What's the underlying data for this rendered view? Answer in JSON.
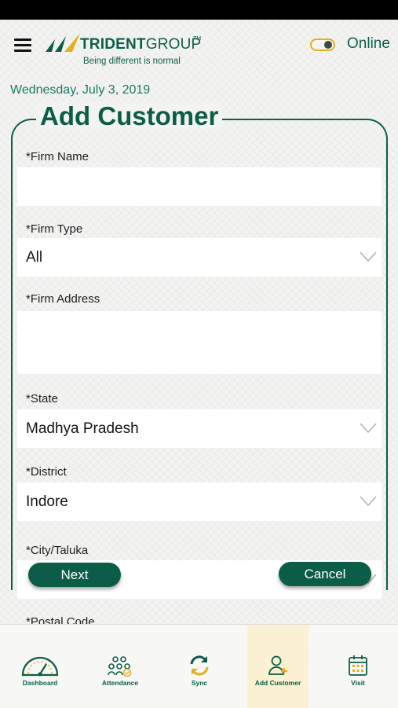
{
  "header": {
    "brand_name": "TRIDENTGROUP",
    "brand_name_bold": "TRIDENT",
    "brand_name_rest": "GROUP",
    "brand_tm": "TM",
    "brand_tagline": "Being different is normal",
    "status_label": "Online",
    "online_toggle_on": true
  },
  "date": "Wednesday, July 3, 2019",
  "form": {
    "title": "Add Customer",
    "fields": [
      {
        "label": "*Firm Name",
        "value": ""
      },
      {
        "label": "*Firm Type",
        "value": "All"
      },
      {
        "label": "*Firm Address",
        "value": ""
      },
      {
        "label": "*State",
        "value": "Madhya Pradesh"
      },
      {
        "label": "*District",
        "value": "Indore"
      },
      {
        "label": "*City/Taluka",
        "value": ""
      },
      {
        "label": "*Postal Code",
        "value": ""
      }
    ]
  },
  "buttons": {
    "next": "Next",
    "cancel": "Cancel"
  },
  "nav": [
    {
      "label": "Dashboard",
      "icon": "gauge-icon"
    },
    {
      "label": "Attendance",
      "icon": "people-group-icon"
    },
    {
      "label": "Sync",
      "icon": "sync-icon"
    },
    {
      "label": "Add Customer",
      "icon": "add-user-icon"
    },
    {
      "label": "Visit",
      "icon": "calendar-icon"
    }
  ],
  "colors": {
    "primary": "#0c5d48",
    "accent": "#e5b01d",
    "active_tab_bg": "#fbf0d2"
  }
}
